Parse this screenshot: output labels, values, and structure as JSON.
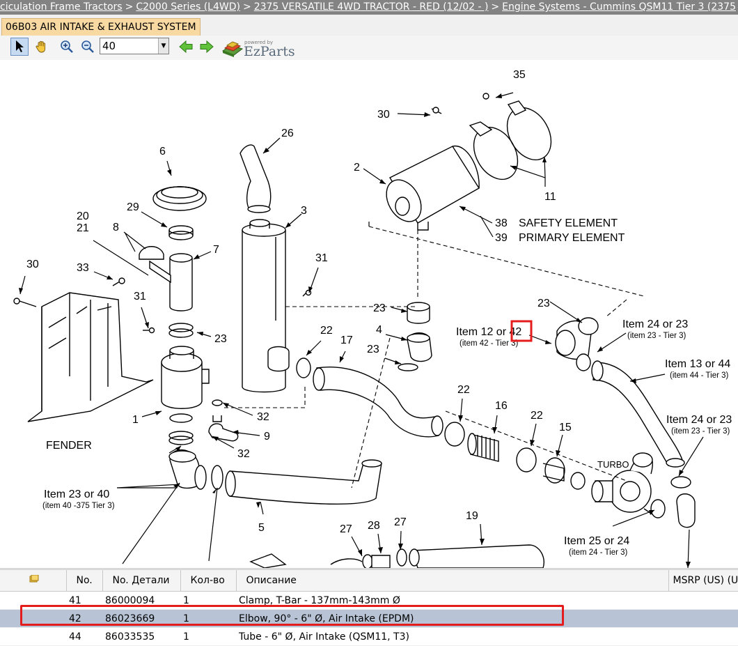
{
  "breadcrumb": [
    {
      "label": "Articulation Frame Tractors",
      "visible": "ciculation Frame Tractors"
    },
    {
      "label": "C2000 Series (L4WD)"
    },
    {
      "label": "2375 VERSATILE 4WD TRACTOR - RED (12/02 - )"
    },
    {
      "label": "Engine Systems - Cummins QSM11 Tier 3 (2375"
    }
  ],
  "tab": {
    "label": "06B03 AIR INTAKE & EXHAUST SYSTEM"
  },
  "toolbar": {
    "zoom_value": "40",
    "logo_powered": "powered by",
    "logo_name": "EzParts"
  },
  "diagram": {
    "labels": {
      "n35": "35",
      "n30a": "30",
      "n26": "26",
      "n6": "6",
      "n2": "2",
      "n11": "11",
      "n3": "3",
      "n29": "29",
      "n20": "20",
      "n21": "21",
      "n8": "8",
      "n7": "7",
      "n38": "38",
      "n39": "39",
      "safety": "SAFETY ELEMENT",
      "primary": "PRIMARY ELEMENT",
      "n30b": "30",
      "n33": "33",
      "n31a": "31",
      "n31b": "31",
      "n23a": "23",
      "n23b": "23",
      "n23c": "23",
      "n23d": "23",
      "n4": "4",
      "n22a": "22",
      "n17": "17",
      "n1": "1",
      "n32a": "32",
      "n9": "9",
      "n32b": "32",
      "fender": "FENDER",
      "n22b": "22",
      "n16": "16",
      "n22c": "22",
      "n15": "15",
      "turbo": "TURBO",
      "n5": "5",
      "n27a": "27",
      "n28": "28",
      "n27b": "27",
      "n19": "19"
    },
    "callouts": {
      "item12_prefix": "Item 12 or ",
      "item12_num": "42",
      "item12_sub": "(item 42 - Tier 3)",
      "item24a": "Item 24 or 23",
      "item24a_sub": "(item 23 - Tier 3)",
      "item13": "Item 13 or 44",
      "item13_sub": "(item 44 - Tier 3)",
      "item24b": "Item 24 or 23",
      "item24b_sub": "(item 23 - Tier 3)",
      "item23": "Item 23 or 40",
      "item23_sub": "(item 40 -375 Tier 3)",
      "item25": "Item 25 or 24",
      "item25_sub": "(item 24 - Tier 3)"
    }
  },
  "grid": {
    "columns": [
      "",
      "No.",
      "No. Детали",
      "Кол-во",
      "Описание",
      "MSRP (US) (U"
    ],
    "rows": [
      {
        "no": "41",
        "part": "86000094",
        "qty": "1",
        "desc": "Clamp, T-Bar - 137mm-143mm Ø",
        "selected": false
      },
      {
        "no": "42",
        "part": "86023669",
        "qty": "1",
        "desc": "Elbow, 90° - 6\" Ø, Air Intake (EPDM)",
        "selected": true
      },
      {
        "no": "44",
        "part": "86033535",
        "qty": "1",
        "desc": "Tube - 6\" Ø, Air Intake (QSM11, T3)",
        "selected": false
      }
    ]
  },
  "colors": {
    "breadcrumb_bg": "#838383",
    "tab_bg": "#f9d9a2",
    "selected_row": "#b8c4d6",
    "highlight": "#e41c1c"
  }
}
